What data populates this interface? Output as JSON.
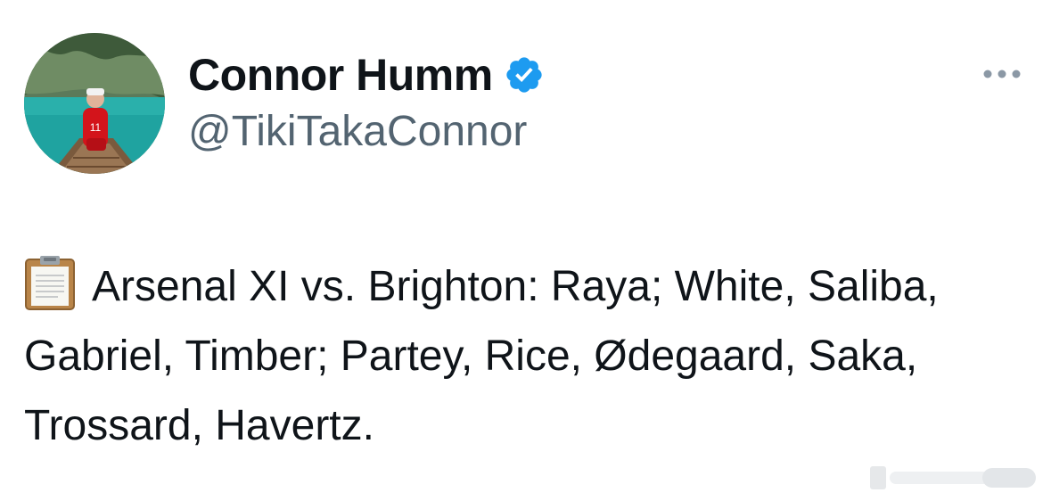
{
  "tweet": {
    "author": {
      "display_name": "Connor Humm",
      "handle": "@TikiTakaConnor",
      "verified": true
    },
    "text": "Arsenal XI vs. Brighton: Raya; White, Saliba, Gabriel, Timber; Partey, Rice, Ødegaard, Saka, Trossard, Havertz.",
    "leading_emoji": "clipboard-icon"
  },
  "icons": {
    "verified": "verified-badge-icon",
    "more": "more-options-icon"
  },
  "colors": {
    "name": "#0f1419",
    "handle": "#536471",
    "verified_badge": "#1d9bf0",
    "background": "#ffffff"
  }
}
